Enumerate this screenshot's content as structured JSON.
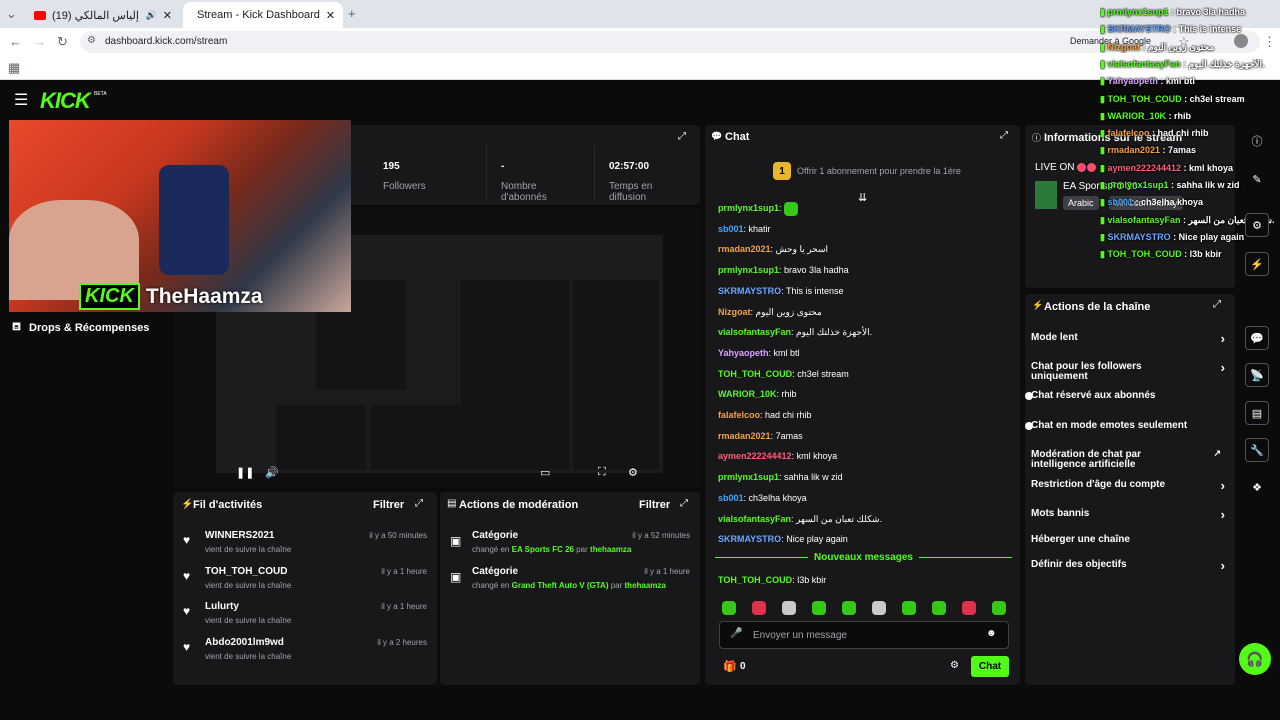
{
  "browser": {
    "tabs": [
      {
        "title": "(19) ردة فعل إلياس المالكي",
        "active": false
      },
      {
        "title": "Stream - Kick Dashboard",
        "active": true
      }
    ],
    "url": "dashboard.kick.com/stream",
    "ask_google": "Demander à Google"
  },
  "header": {
    "logo": "KICK",
    "beta": "BETA"
  },
  "stats": [
    {
      "value": "195",
      "label": "Followers"
    },
    {
      "value": "-",
      "label": "Nombre d'abonnés"
    },
    {
      "value": "02:57:00",
      "label": "Temps en diffusion"
    }
  ],
  "webcam": {
    "brand": "KICK",
    "name": "TheHaamza"
  },
  "sidebar": {
    "drops": "Drops & Récompenses"
  },
  "activity": {
    "title": "Fil d'activités",
    "filter": "Filtrer",
    "items": [
      {
        "user": "WINNERS2021",
        "text": "vient de suivre la chaîne",
        "time": "il y a 50 minutes"
      },
      {
        "user": "TOH_TOH_COUD",
        "text": "vient de suivre la chaîne",
        "time": "il y a 1 heure"
      },
      {
        "user": "Lulurty",
        "text": "vient de suivre la chaîne",
        "time": "il y a 1 heure"
      },
      {
        "user": "Abdo2001lm9wd",
        "text": "vient de suivre la chaîne",
        "time": "il y a 2 heures"
      }
    ]
  },
  "modactions": {
    "title": "Actions de modération",
    "filter": "Filtrer",
    "items": [
      {
        "title": "Catégorie",
        "prefix": "changé en",
        "value": "EA Sports FC 26",
        "by": "par",
        "user": "thehaamza",
        "time": "il y a 52 minutes"
      },
      {
        "title": "Catégorie",
        "prefix": "changé en",
        "value": "Grand Theft Auto V (GTA)",
        "by": "par",
        "user": "thehaamza",
        "time": "il y a 1 heure"
      }
    ]
  },
  "chat": {
    "title": "Chat",
    "sub_badge": "1",
    "sub_offer": "Offrir 1 abonnement pour prendre la 1ère",
    "messages": [
      {
        "user": "prmlynx1sup1",
        "color": "#53fc18",
        "text": ""
      },
      {
        "user": "sb001",
        "color": "#3fa7ff",
        "text": "khatir"
      },
      {
        "user": "rmadan2021",
        "color": "#f5a142",
        "text": "اسحر يا وحش"
      },
      {
        "user": "prmlynx1sup1",
        "color": "#53fc18",
        "text": "bravo 3la hadha"
      },
      {
        "user": "SKRMAYSTRO",
        "color": "#6aa6ff",
        "text": "This is intense"
      },
      {
        "user": "Nizgoat",
        "color": "#f5a142",
        "text": "محتوى زوين اليوم"
      },
      {
        "user": "vialsofantasyFan",
        "color": "#53fc18",
        "text": "الأجهزة خذلتك اليوم."
      },
      {
        "user": "Yahyaopeth",
        "color": "#d8a6ff",
        "text": "kml btl"
      },
      {
        "user": "TOH_TOH_COUD",
        "color": "#53fc18",
        "text": "ch3el stream"
      },
      {
        "user": "WARIOR_10K",
        "color": "#53fc18",
        "text": "rhib"
      },
      {
        "user": "falafelcoo",
        "color": "#f5a142",
        "text": "had chi rhib"
      },
      {
        "user": "rmadan2021",
        "color": "#f5a142",
        "text": "7amas"
      },
      {
        "user": "aymen222244412",
        "color": "#ff5b7a",
        "text": "kml khoya"
      },
      {
        "user": "prmlynx1sup1",
        "color": "#53fc18",
        "text": "sahha lik w zid"
      },
      {
        "user": "sb001",
        "color": "#3fa7ff",
        "text": "ch3elha khoya"
      },
      {
        "user": "vialsofantasyFan",
        "color": "#53fc18",
        "text": "شكلك تعبان من السهر."
      },
      {
        "user": "SKRMAYSTRO",
        "color": "#6aa6ff",
        "text": "Nice play again"
      }
    ],
    "new_messages": "Nouveaux messages",
    "last": {
      "user": "TOH_TOH_COUD",
      "color": "#53fc18",
      "text": "l3b kbir"
    },
    "placeholder": "Envoyer un message",
    "count": "0",
    "send": "Chat"
  },
  "info": {
    "title": "Informations sur le stream",
    "live_on": "LIVE ON",
    "game": "EA Sports FC 26",
    "lang": "Arabic",
    "tag": "MKCcommunity"
  },
  "overlay_chat": [
    {
      "user": "prmlynx1sup1",
      "color": "#53fc18",
      "text": "bravo 3la hadha"
    },
    {
      "user": "SKRMAYSTRO",
      "color": "#6aa6ff",
      "text": "This is intense"
    },
    {
      "user": "Nizgoat",
      "color": "#f5a142",
      "text": "محتوى زوين اليوم"
    },
    {
      "user": "vialsofantasyFan",
      "color": "#53fc18",
      "text": "الأجهزة خذلتك اليوم."
    },
    {
      "user": "Yahyaopeth",
      "color": "#d8a6ff",
      "text": "kml btl"
    },
    {
      "user": "TOH_TOH_COUD",
      "color": "#53fc18",
      "text": "ch3el stream"
    },
    {
      "user": "WARIOR_10K",
      "color": "#53fc18",
      "text": "rhib"
    },
    {
      "user": "falafelcoo",
      "color": "#f5a142",
      "text": "had chi rhib"
    },
    {
      "user": "rmadan2021",
      "color": "#f5a142",
      "text": "7amas"
    },
    {
      "user": "aymen222244412",
      "color": "#ff5b7a",
      "text": "kml khoya"
    },
    {
      "user": "prmlynx1sup1",
      "color": "#53fc18",
      "text": "sahha lik w zid"
    },
    {
      "user": "sb001",
      "color": "#3fa7ff",
      "text": "ch3elha khoya"
    },
    {
      "user": "vialsofantasyFan",
      "color": "#53fc18",
      "text": "شكلك تعبان من السهر."
    },
    {
      "user": "SKRMAYSTRO",
      "color": "#6aa6ff",
      "text": "Nice play again"
    },
    {
      "user": "TOH_TOH_COUD",
      "color": "#53fc18",
      "text": "l3b kbir"
    }
  ],
  "channel": {
    "title": "Actions de la chaîne",
    "items": [
      {
        "label": "Mode lent",
        "control": "chevron"
      },
      {
        "label": "Chat pour les followers uniquement",
        "control": "chevron"
      },
      {
        "label": "Chat réservé aux abonnés",
        "control": "toggle"
      },
      {
        "label": "Chat en mode emotes seulement",
        "control": "toggle"
      },
      {
        "label": "Modération de chat par intelligence artificielle",
        "control": "external"
      },
      {
        "label": "Restriction d'âge du compte",
        "control": "chevron"
      },
      {
        "label": "Mots bannis",
        "control": "chevron"
      },
      {
        "label": "Héberger une chaîne",
        "control": "none"
      },
      {
        "label": "Définir des objectifs",
        "control": "chevron"
      }
    ]
  },
  "colors": {
    "accent": "#53fc18",
    "panel": "#18181b",
    "bg": "#0b0b0c"
  }
}
